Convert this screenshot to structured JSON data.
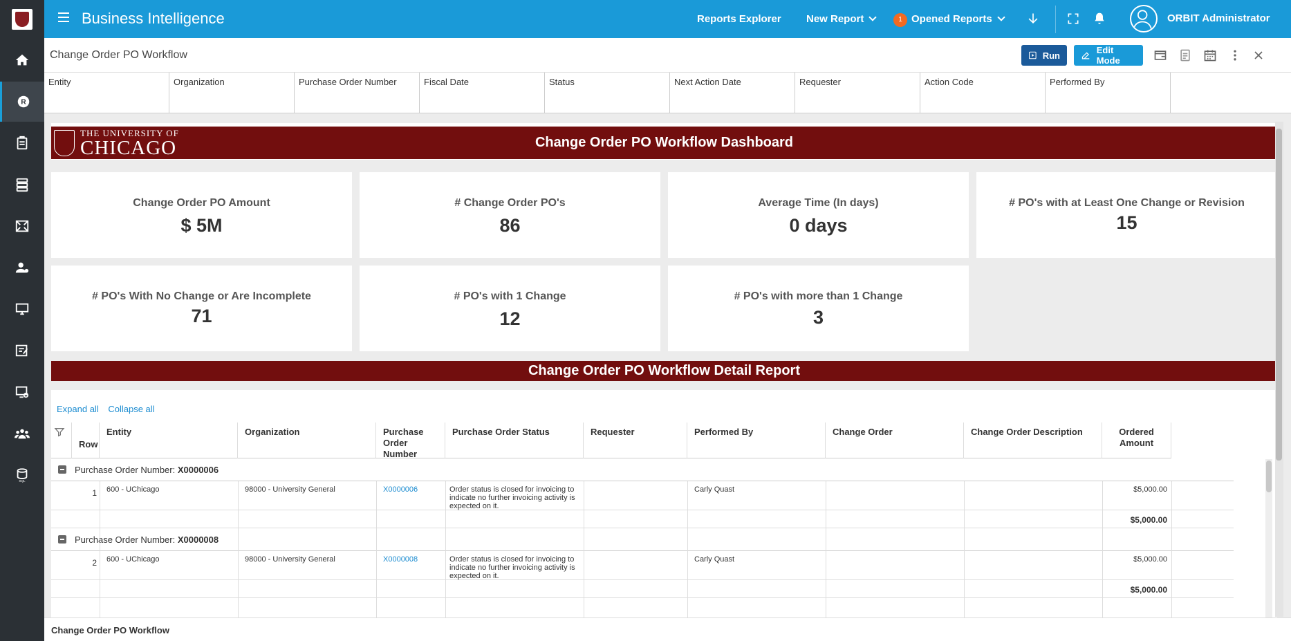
{
  "topbar": {
    "app_title": "Business Intelligence",
    "reports_explorer": "Reports Explorer",
    "new_report": "New Report",
    "opened_reports_count": "1",
    "opened_reports": "Opened Reports",
    "user_name": "ORBIT Administrator"
  },
  "subheader": {
    "title": "Change Order PO Workflow",
    "run_label": "Run",
    "edit_mode_label": "Edit Mode"
  },
  "filters": [
    "Entity",
    "Organization",
    "Purchase Order Number",
    "Fiscal Date",
    "Status",
    "Next Action Date",
    "Requester",
    "Action Code",
    "Performed By"
  ],
  "dashboard": {
    "logo_line1": "THE UNIVERSITY OF",
    "logo_line2": "CHICAGO",
    "title": "Change Order PO Workflow Dashboard",
    "kpis": [
      {
        "label": "Change Order PO Amount",
        "value": "$ 5M"
      },
      {
        "label": "# Change Order PO's",
        "value": "86"
      },
      {
        "label": "Average Time (In days)",
        "value": "0 days"
      },
      {
        "label": "# PO's with at Least One Change or Revision",
        "value": "15"
      },
      {
        "label": "# PO's With No Change or Are Incomplete",
        "value": "71"
      },
      {
        "label": "# PO's with 1 Change",
        "value": "12"
      },
      {
        "label": "# PO's with more than 1 Change",
        "value": "3"
      }
    ]
  },
  "detail": {
    "title": "Change Order PO Workflow Detail Report",
    "expand_all": "Expand all",
    "collapse_all": "Collapse all",
    "columns": [
      "Row",
      "Entity",
      "Organization",
      "Purchase Order Number",
      "Purchase Order Status",
      "Requester",
      "Performed By",
      "Change Order",
      "Change Order Description",
      "Ordered Amount"
    ],
    "group_prefix": "Purchase Order Number: ",
    "groups": [
      {
        "po": "X0000006",
        "row": "1",
        "entity": "600 - UChicago",
        "organization": "98000 - University General",
        "po_link": "X0000006",
        "status": "Order status is closed for invoicing to indicate no further invoicing activity is expected on it.",
        "requester": "",
        "performed_by": "Carly Quast",
        "change_order": "",
        "change_desc": "",
        "amount": "$5,000.00",
        "total": "$5,000.00"
      },
      {
        "po": "X0000008",
        "row": "2",
        "entity": "600 - UChicago",
        "organization": "98000 - University General",
        "po_link": "X0000008",
        "status": "Order status is closed for invoicing to indicate no further invoicing activity is expected on it.",
        "requester": "",
        "performed_by": "Carly Quast",
        "change_order": "",
        "change_desc": "",
        "amount": "$5,000.00",
        "total": "$5,000.00"
      }
    ]
  },
  "footer": {
    "title": "Change Order PO Workflow"
  },
  "colors": {
    "primary": "#1a9ad8",
    "sidebar": "#2b3035",
    "maroon": "#720e0e",
    "run_button": "#1b5a9a",
    "badge": "#f26a21"
  }
}
